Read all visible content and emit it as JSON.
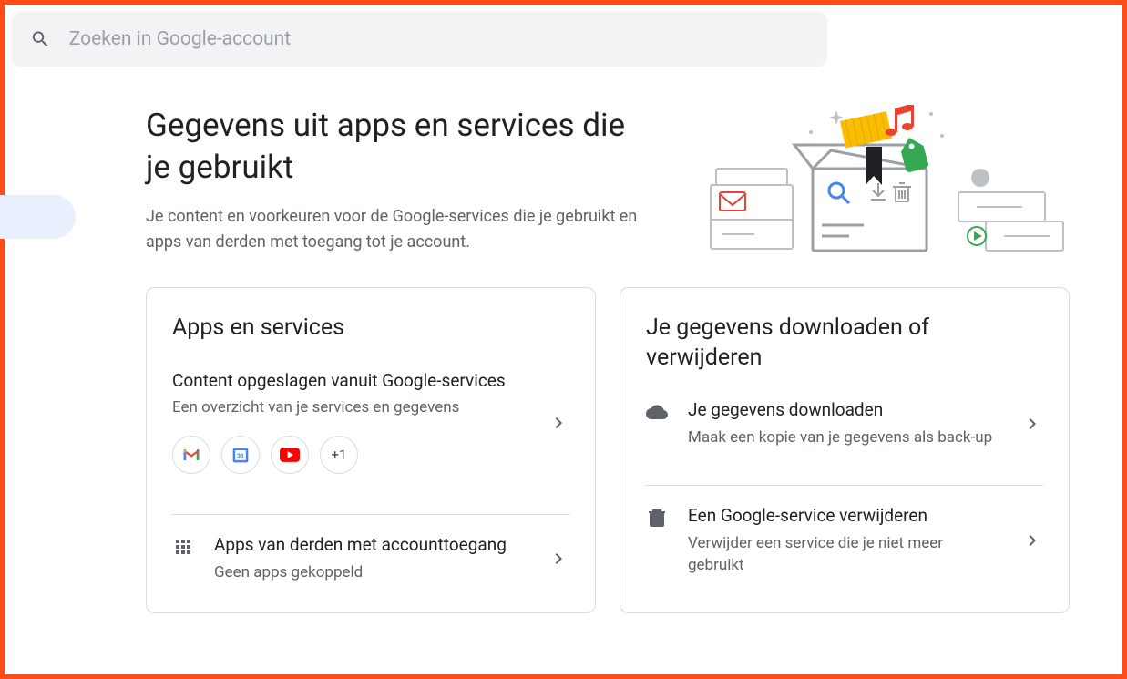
{
  "search": {
    "placeholder": "Zoeken in Google-account"
  },
  "header": {
    "title": "Gegevens uit apps en services die je gebruikt",
    "subtitle": "Je content en voorkeuren voor de Google-services die je gebruikt en apps van derden met toegang tot je account."
  },
  "card_apps": {
    "title": "Apps en services",
    "content": {
      "title": "Content opgeslagen vanuit Google-services",
      "subtitle": "Een overzicht van je services en gegevens",
      "more_chip": "+1"
    },
    "third_party": {
      "title": "Apps van derden met accounttoegang",
      "subtitle": "Geen apps gekoppeld"
    }
  },
  "card_data": {
    "title": "Je gegevens downloaden of verwijderen",
    "download": {
      "title": "Je gegevens downloaden",
      "subtitle": "Maak een kopie van je gegevens als back-up"
    },
    "delete": {
      "title": "Een Google-service verwijderen",
      "subtitle": "Verwijder een service die je niet meer gebruikt"
    }
  }
}
